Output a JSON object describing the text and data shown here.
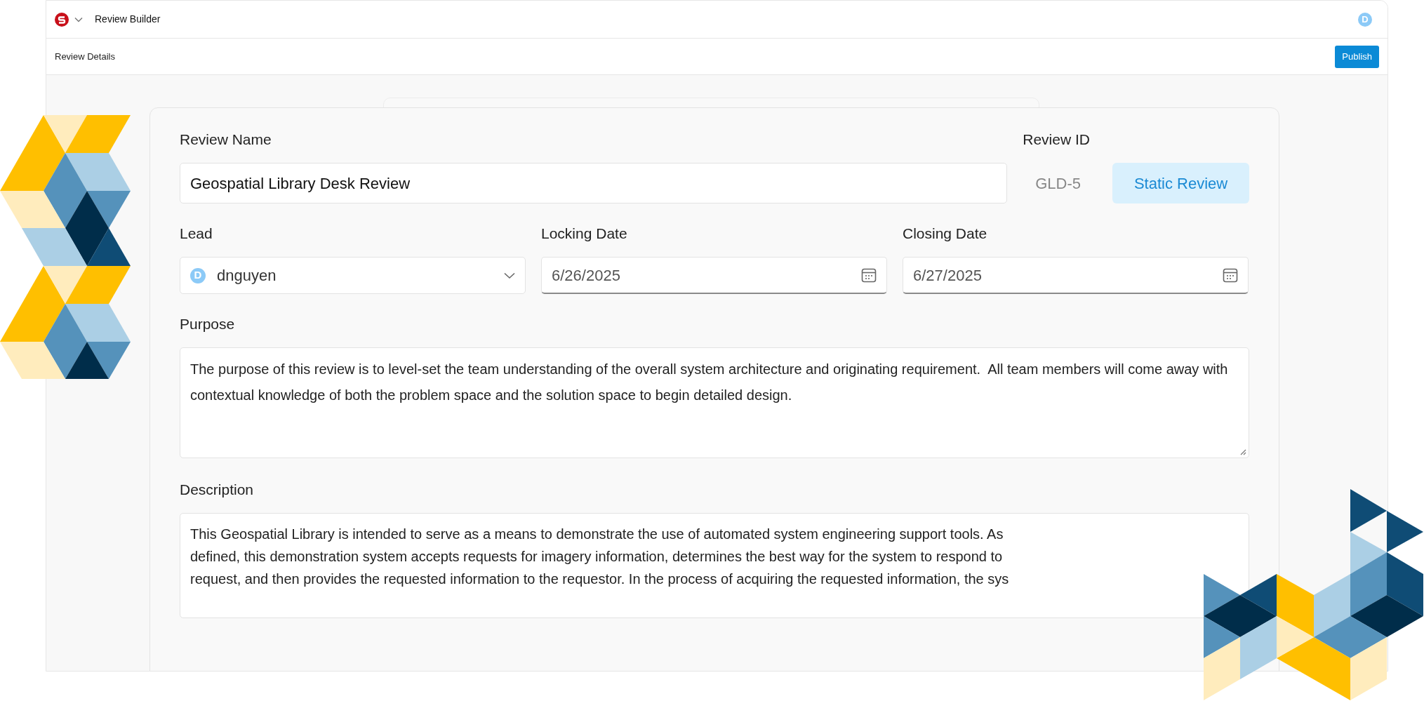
{
  "app_bar": {
    "title": "Review Builder",
    "avatar": "D"
  },
  "toolbar": {
    "title": "Review Details",
    "publish_button": "Publish"
  },
  "form": {
    "review_name": {
      "label": "Review Name",
      "value": "Geospatial Library Desk Review"
    },
    "review_id": {
      "label": "Review ID",
      "value": "GLD-5",
      "badge": "Static Review"
    },
    "lead": {
      "label": "Lead",
      "avatar": "D",
      "value": "dnguyen"
    },
    "locking_date": {
      "label": "Locking Date",
      "value": "6/26/2025"
    },
    "closing_date": {
      "label": "Closing Date",
      "value": "6/27/2025"
    },
    "purpose": {
      "label": "Purpose",
      "value": "The purpose of this review is to level-set the team understanding of the overall system architecture and originating requirement.  All team members will come away with contextual knowledge of both the problem space and the solution space to begin detailed design."
    },
    "description": {
      "label": "Description",
      "lines": [
        "This Geospatial Library is intended to serve as a means to demonstrate the use of automated system engineering support tools. As",
        "defined, this demonstration system accepts requests for imagery information, determines the best way for the system to respond to",
        "request, and then provides the requested information to the requestor. In the process of acquiring the requested information, the sys"
      ]
    }
  }
}
